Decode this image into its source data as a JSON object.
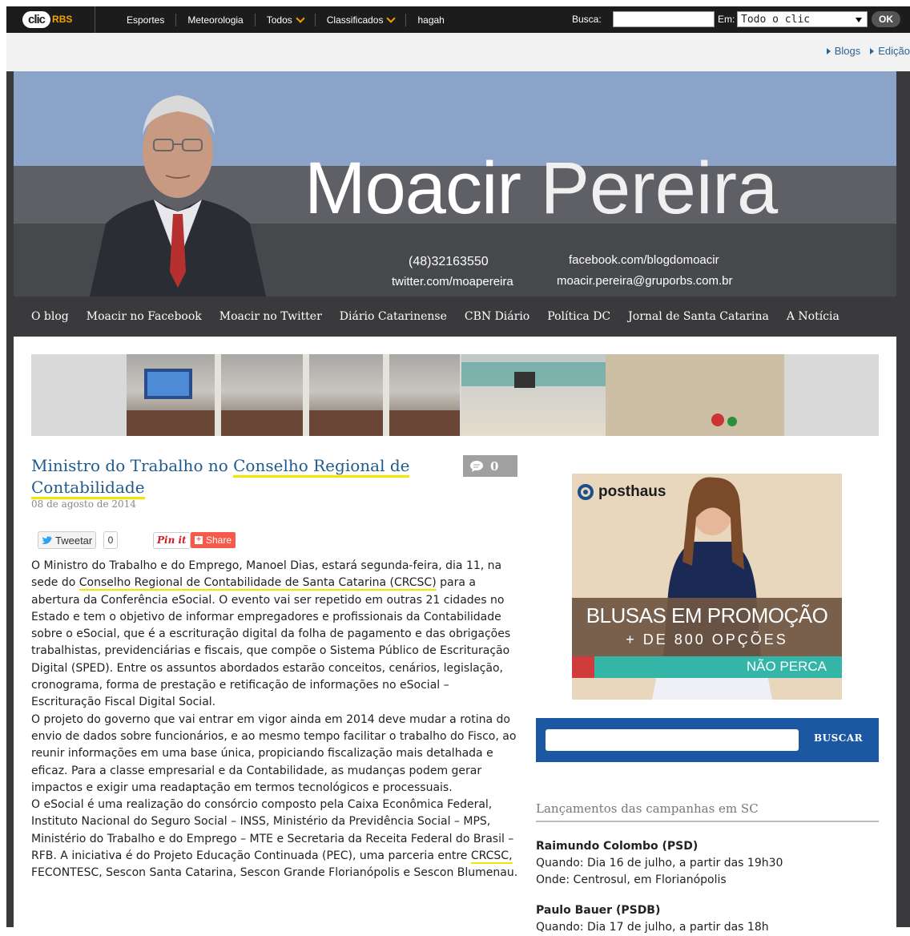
{
  "topbar": {
    "logo_clic": "clic",
    "logo_rbs": "RBS",
    "nav": [
      {
        "label": "Esportes",
        "dropdown": false
      },
      {
        "label": "Meteorologia",
        "dropdown": false
      },
      {
        "label": "Todos",
        "dropdown": true
      },
      {
        "label": "Classificados",
        "dropdown": true
      },
      {
        "label": "hagah",
        "dropdown": false
      }
    ],
    "busca_label": "Busca:",
    "busca_value": "",
    "em_label": "Em:",
    "em_selected": "Todo o clic",
    "ok_label": "OK"
  },
  "subbar": {
    "links": [
      "Blogs",
      "Edição"
    ]
  },
  "header": {
    "title_bold": "Moacir",
    "title_light": "Pereira",
    "phone": "(48)32163550",
    "twitter": "twitter.com/moapereira",
    "facebook": "facebook.com/blogdomoacir",
    "email": "moacir.pereira@gruporbs.com.br"
  },
  "mainnav": [
    "O blog",
    "Moacir no Facebook",
    "Moacir no Twitter",
    "Diário Catarinense",
    "CBN Diário",
    "Política DC",
    "Jornal de Santa Catarina",
    "A Notícia"
  ],
  "post": {
    "title_part1": "Ministro do Trabalho no ",
    "title_hl1": "Conselho Regional de",
    "title_hl2": "Contabilidade",
    "comments": "0",
    "date": "08 de agosto de 2014",
    "tweet_label": "Tweetar",
    "tweet_count": "0",
    "pin_label": "Pin it",
    "share_label": "Share",
    "p1_before": "O Ministro do Trabalho e do Emprego, Manoel Dias, estará segunda-feira, dia 11, na sede do ",
    "p1_hl": "Conselho Regional de Contabilidade de Santa Catarina (CRCSC)",
    "p1_after": " para a abertura da Conferência eSocial. O evento vai ser repetido em outras 21 cidades no Estado e tem o objetivo de informar empregadores e profissionais da Contabilidade sobre o eSocial, que é a escrituração digital da folha de pagamento e das obrigações trabalhistas, previdenciárias e fiscais, que compõe o Sistema Público de Escrituração Digital (SPED). Entre os assuntos abordados estarão conceitos, cenários, legislação, cronograma, forma de prestação e retificação de informações no eSocial – Escrituração Fiscal Digital Social.",
    "p2": "O projeto do governo que vai entrar em vigor ainda em 2014 deve mudar a rotina do envio de dados sobre funcionários, e ao mesmo tempo facilitar o trabalho do Fisco, ao reunir informações em uma base única, propiciando fiscalização mais detalhada e eficaz. Para a classe empresarial e da Contabilidade, as mudanças podem gerar impactos e exigir uma readaptação em termos tecnológicos e processuais.",
    "p3_before": "O eSocial é uma realização do consórcio composto pela Caixa Econômica Federal, Instituto Nacional do Seguro Social – INSS, Ministério da Previdência Social – MPS, Ministério do Trabalho e do Emprego – MTE e Secretaria da Receita Federal do Brasil – RFB. A iniciativa é do Projeto Educação Continuada (PEC), uma parceria entre ",
    "p3_hl": "CRCSC,",
    "p3_after": " FECONTESC, Sescon Santa Catarina, Sescon Grande Florianópolis e Sescon Blumenau."
  },
  "ad": {
    "brand": "posthaus",
    "line1": "BLUSAS EM PROMOÇÃO",
    "line2": "+ DE 800 OPÇÕES",
    "line3": "NÃO PERCA"
  },
  "sidebar": {
    "search_value": "",
    "search_button": "BUSCAR",
    "section_title": "Lançamentos das campanhas em SC",
    "campaigns": [
      {
        "name": "Raimundo Colombo (PSD)",
        "when": "Quando: Dia 16 de julho, a partir das 19h30",
        "where": "Onde: Centrosul, em Florianópolis"
      },
      {
        "name": "Paulo Bauer (PSDB)",
        "when": "Quando: Dia 17 de julho, a partir das 18h",
        "where": ""
      }
    ]
  },
  "colors": {
    "link_blue": "#1f5a8f",
    "highlight": "#f5e500",
    "search_blue": "#1c58a1",
    "header_sky": "#8ca3c9"
  }
}
